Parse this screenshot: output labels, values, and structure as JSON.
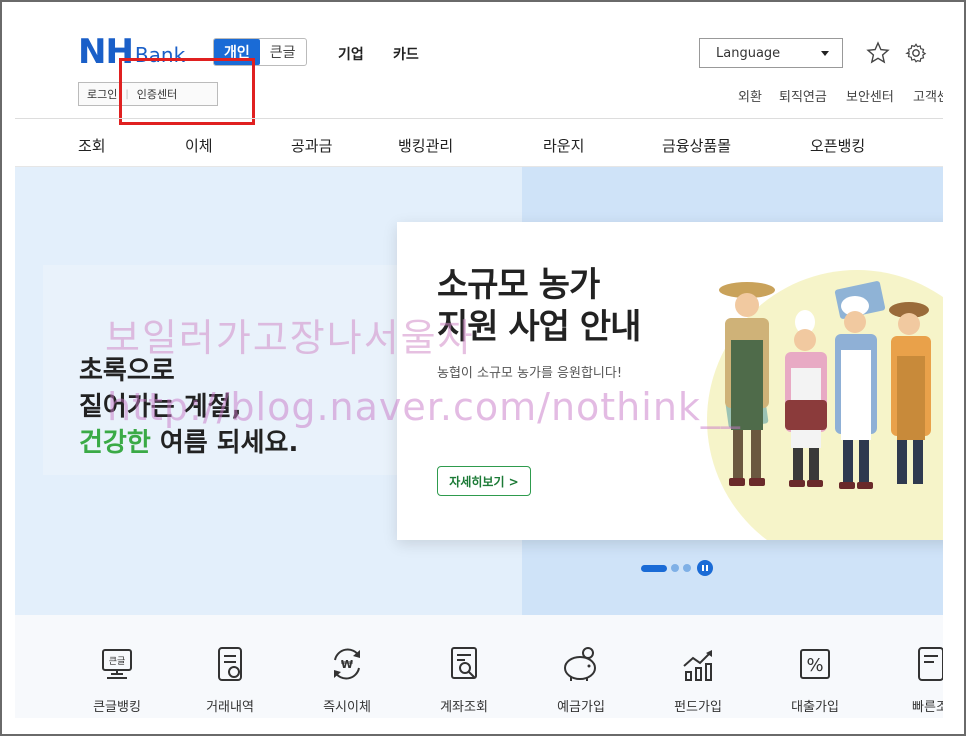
{
  "header": {
    "logo_main": "NH",
    "logo_sub": "Bank",
    "segments": [
      "개인",
      "큰글"
    ],
    "top_menu": [
      "기업",
      "카드"
    ],
    "auth": {
      "login": "로그인",
      "cert_center": "인증센터"
    },
    "language": "Language",
    "util_links": [
      "외환",
      "퇴직연금",
      "보안센터",
      "고객센"
    ]
  },
  "gnb": [
    "조회",
    "이체",
    "공과금",
    "뱅킹관리",
    "라운지",
    "금융상품몰",
    "오픈뱅킹"
  ],
  "hero": {
    "slogan_line1": "초록으로",
    "slogan_line2": "짙어가는 계절,",
    "slogan_line3_green": "건강한",
    "slogan_line3_rest": " 여름 되세요.",
    "banner_title_line1": "소규모 농가",
    "banner_title_line2": "지원 사업 안내",
    "banner_sub": "농협이 소규모 농가를 응원합니다!",
    "banner_button": "자세히보기 >",
    "watermark_line1": "보일러가고장나서울자",
    "watermark_line2": "http://blog.naver.com/nothink__"
  },
  "quick_menu": [
    "큰글뱅킹",
    "거래내역",
    "즉시이체",
    "계좌조회",
    "예금가입",
    "펀드가입",
    "대출가입",
    "빠른조"
  ],
  "colors": {
    "brand_blue": "#1a5fc8",
    "green": "#3aaa46",
    "highlight_red": "#e02020"
  }
}
